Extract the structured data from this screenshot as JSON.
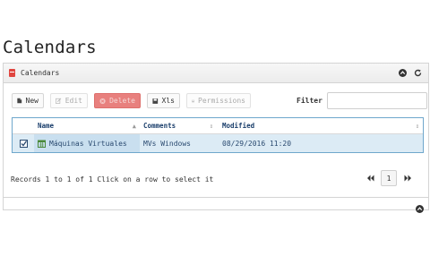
{
  "page": {
    "title": "Calendars"
  },
  "panel": {
    "title": "Calendars",
    "toolbar": {
      "new_label": "New",
      "edit_label": "Edit",
      "delete_label": "Delete",
      "xls_label": "Xls",
      "permissions_label": "Permissions",
      "filter_label": "Filter",
      "filter_value": ""
    },
    "grid": {
      "columns": [
        "Name",
        "Comments",
        "Modified"
      ],
      "rows": [
        {
          "name": "Máquinas Virtuales",
          "comments": "MVs Windows",
          "modified": "08/29/2016 11:20"
        }
      ]
    },
    "footer": {
      "status": "Records 1 to 1 of 1  Click on a row to select it",
      "page": "1"
    }
  },
  "colors": {
    "accent": "#6fa7cc",
    "danger": "#e8807e",
    "selected_row": "#dcebf5"
  }
}
